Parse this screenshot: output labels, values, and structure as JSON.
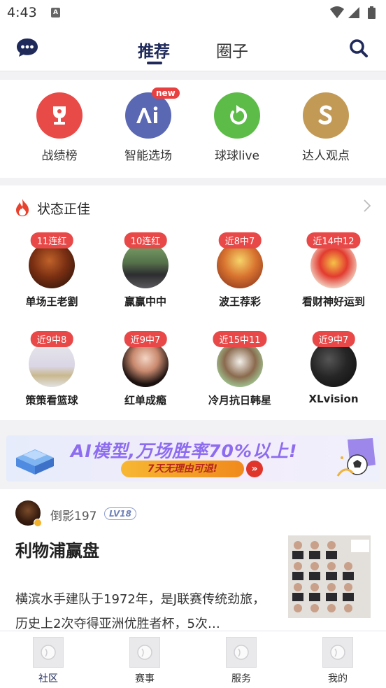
{
  "status_bar": {
    "time": "4:43",
    "sim_icon": "A"
  },
  "header": {
    "tabs": [
      {
        "label": "推荐",
        "active": true
      },
      {
        "label": "圈子",
        "active": false
      }
    ],
    "left_icon": "chat-bubble-icon",
    "right_icon": "search-icon"
  },
  "shortcuts": [
    {
      "label": "战绩榜",
      "icon": "trophy-icon",
      "color": "#e84a48"
    },
    {
      "label": "智能选场",
      "icon": "ai-icon",
      "color": "#5a68b3",
      "badge": "new"
    },
    {
      "label": "球球live",
      "icon": "refresh-arrow-icon",
      "color": "#5cbc47"
    },
    {
      "label": "达人观点",
      "icon": "s-icon",
      "color": "#c29a55"
    }
  ],
  "hot_section": {
    "title": "状态正佳",
    "experts": [
      {
        "badge": "11连红",
        "name": "单场王老劉"
      },
      {
        "badge": "10连红",
        "name": "赢赢中中"
      },
      {
        "badge": "近8中7",
        "name": "波王荐彩"
      },
      {
        "badge": "近14中12",
        "name": "看财神好运到"
      },
      {
        "badge": "近9中8",
        "name": "策策看篮球"
      },
      {
        "badge": "近9中7",
        "name": "红单成瘾"
      },
      {
        "badge": "近15中11",
        "name": "冷月抗日韩星"
      },
      {
        "badge": "近9中7",
        "name": "XLvision"
      }
    ]
  },
  "banner": {
    "title": "AI模型,万场胜率70%以上!",
    "subtitle": "7天无理由可退!"
  },
  "post": {
    "author": "倒影197",
    "level": "LV18",
    "title": "利物浦赢盘",
    "body": "横滨水手建队于1972年，是J联赛传统劲旅，历史上2次夺得亚洲优胜者杯，5次…"
  },
  "tab_bar": [
    {
      "label": "社区",
      "active": true
    },
    {
      "label": "赛事",
      "active": false
    },
    {
      "label": "服务",
      "active": false
    },
    {
      "label": "我的",
      "active": false
    }
  ],
  "colors": {
    "accent": "#1f2a5a",
    "badge_red": "#e84848"
  }
}
